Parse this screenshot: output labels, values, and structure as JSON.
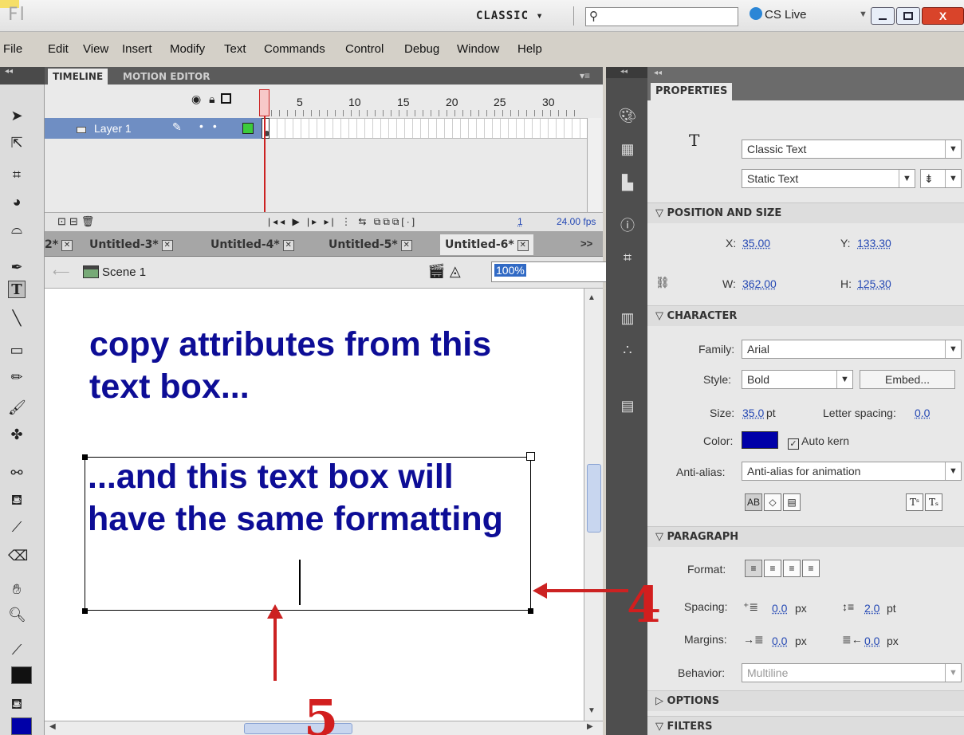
{
  "app": {
    "logo": "Fl",
    "workspace": "CLASSIC ▾",
    "cs_live": "CS Live",
    "close_glyph": "X"
  },
  "menu": [
    "File",
    "Edit",
    "View",
    "Insert",
    "Modify",
    "Text",
    "Commands",
    "Control",
    "Debug",
    "Window",
    "Help"
  ],
  "timeline": {
    "tabs": [
      "TIMELINE",
      "MOTION EDITOR"
    ],
    "frame_numbers": [
      "1",
      "5",
      "10",
      "15",
      "20",
      "25",
      "30"
    ],
    "layer_name": "Layer 1",
    "current_frame": "1",
    "fps": "24.00 fps"
  },
  "documents": {
    "tabs": [
      "2*",
      "Untitled-3*",
      "Untitled-4*",
      "Untitled-5*",
      "Untitled-6*"
    ],
    "active": "Untitled-6*",
    "more": ">>"
  },
  "scene": {
    "label": "Scene 1",
    "zoom": "100%"
  },
  "stage": {
    "text_a": "copy attributes from this text box...",
    "text_b": "...and this text box will have the same formatting"
  },
  "properties": {
    "tab": "PROPERTIES",
    "text_engine": "Classic Text",
    "text_type": "Static Text",
    "sections": {
      "position": "POSITION AND SIZE",
      "character": "CHARACTER",
      "paragraph": "PARAGRAPH",
      "options": "OPTIONS",
      "filters": "FILTERS"
    },
    "x_label": "X:",
    "x": "35.00",
    "y_label": "Y:",
    "y": "133.30",
    "w_label": "W:",
    "w": "362.00",
    "h_label": "H:",
    "h": "125.30",
    "family_label": "Family:",
    "family": "Arial",
    "style_label": "Style:",
    "style": "Bold",
    "embed_label": "Embed...",
    "size_label": "Size:",
    "size": "35.0",
    "size_unit": "pt",
    "letter_spacing_label": "Letter spacing:",
    "letter_spacing": "0.0",
    "color_label": "Color:",
    "color": "#0000a8",
    "auto_kern": "Auto kern",
    "anti_alias_label": "Anti-alias:",
    "anti_alias": "Anti-alias for animation",
    "format_label": "Format:",
    "spacing_label": "Spacing:",
    "indent": "0.0",
    "indent_unit": "px",
    "line_spacing": "2.0",
    "line_spacing_unit": "pt",
    "margins_label": "Margins:",
    "margin_left": "0.0",
    "margin_left_unit": "px",
    "margin_right": "0.0",
    "margin_right_unit": "px",
    "behavior_label": "Behavior:",
    "behavior": "Multiline"
  },
  "annotations": {
    "label_4": "4",
    "label_5": "5"
  },
  "colors": {
    "annotation": "#cc2222",
    "text_fill": "#0000a8",
    "selected_layer": "#6f8ec3"
  }
}
